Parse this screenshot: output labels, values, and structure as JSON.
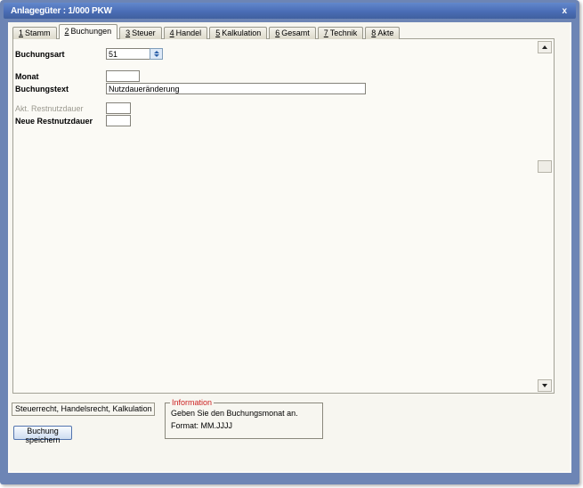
{
  "window": {
    "title": "Anlagegüter : 1/000 PKW",
    "close_icon": "x"
  },
  "tabs": [
    {
      "num": "1",
      "label": "Stamm"
    },
    {
      "num": "2",
      "label": "Buchungen"
    },
    {
      "num": "3",
      "label": "Steuer"
    },
    {
      "num": "4",
      "label": "Handel"
    },
    {
      "num": "5",
      "label": "Kalkulation"
    },
    {
      "num": "6",
      "label": "Gesamt"
    },
    {
      "num": "7",
      "label": "Technik"
    },
    {
      "num": "8",
      "label": "Akte"
    }
  ],
  "form": {
    "buchungsart": {
      "label": "Buchungsart",
      "value": "51"
    },
    "monat": {
      "label": "Monat",
      "value": ""
    },
    "buchungstext": {
      "label": "Buchungstext",
      "value": "Nutzdaueränderung"
    },
    "akt_restnutzdauer": {
      "label": "Akt. Restnutzdauer",
      "value": ""
    },
    "neue_restnutzdauer": {
      "label": "Neue Restnutzdauer",
      "value": ""
    }
  },
  "footer": {
    "scope_text": "Steuerrecht, Handelsrecht, Kalkulation",
    "save_button_label": "Buchung speichern",
    "info": {
      "title": "Information",
      "line1": "Geben Sie den Buchungsmonat an.",
      "line2": "Format: MM.JJJJ"
    }
  },
  "colors": {
    "frame": "#6d85b5",
    "titlebar_top": "#6288cc",
    "titlebar_bottom": "#40609e",
    "content_bg": "#f7f6f0",
    "info_title_red": "#cc2222",
    "disabled_label": "#9b998f",
    "button_border": "#5274ae"
  }
}
